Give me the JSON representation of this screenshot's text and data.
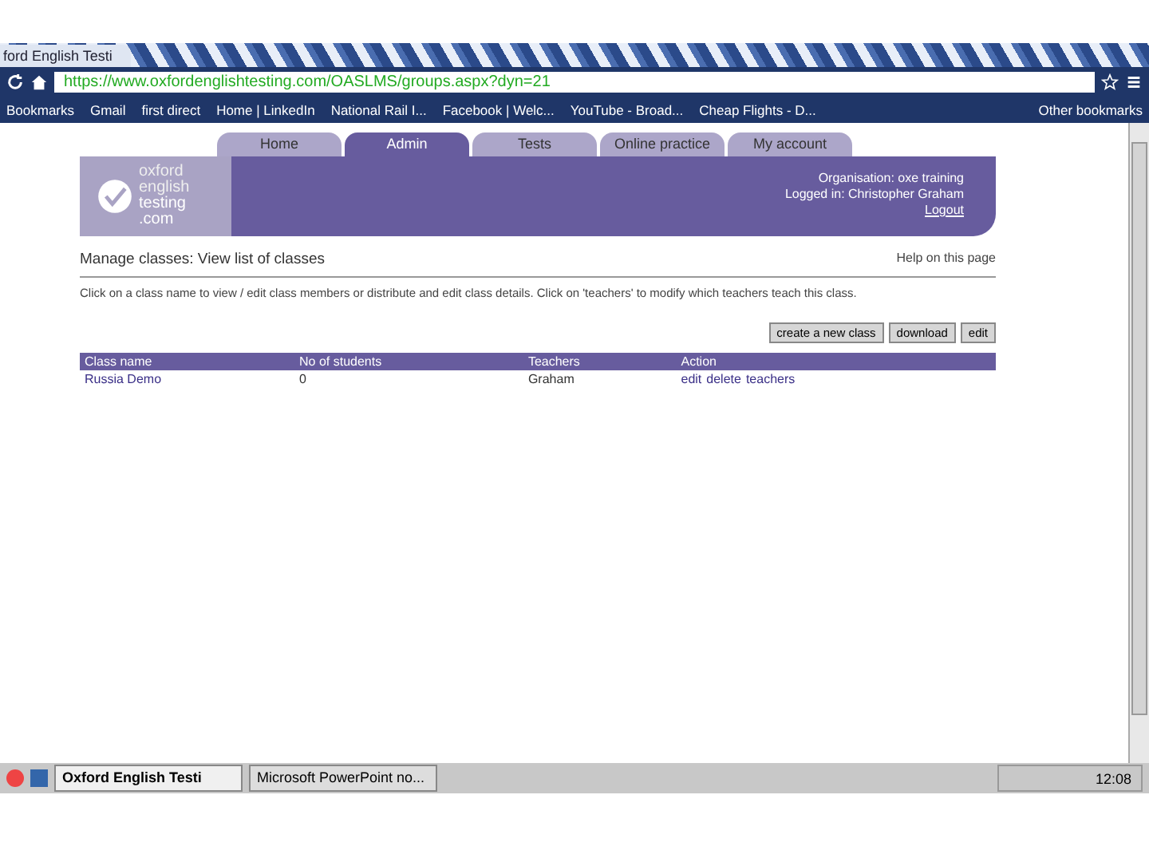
{
  "browser": {
    "tab_title": "ford English Testi",
    "url": "https://www.oxfordenglishtesting.com/OASLMS/groups.aspx?dyn=21",
    "bookmarks": [
      "Bookmarks",
      "Gmail",
      "first direct",
      "Home | LinkedIn",
      "National Rail I...",
      "Facebook | Welc...",
      "YouTube - Broad...",
      "Cheap Flights - D..."
    ],
    "other_bookmarks": "Other bookmarks"
  },
  "nav_tabs": [
    {
      "label": "Home",
      "selected": false
    },
    {
      "label": "Admin",
      "selected": true
    },
    {
      "label": "Tests",
      "selected": false
    },
    {
      "label": "Online practice",
      "selected": false
    },
    {
      "label": "My account",
      "selected": false
    }
  ],
  "logo": [
    "oxford",
    "english",
    "testing",
    ".com"
  ],
  "header": {
    "organisation": "Organisation: oxe training",
    "logged_in": "Logged in: Christopher Graham",
    "logout": "Logout"
  },
  "page_title": "Manage classes: View list of classes",
  "help": "Help on this page",
  "instructions": "Click on a class name to view / edit class members or distribute and edit class details. Click on 'teachers' to modify which teachers teach this class.",
  "buttons": [
    "create a new class",
    "download",
    "edit"
  ],
  "table": {
    "columns": [
      "Class name",
      "No of students",
      "Teachers",
      "Action"
    ],
    "rows": [
      {
        "class_name": "Russia Demo",
        "students": "0",
        "teachers": "Graham",
        "actions": [
          "edit",
          "delete",
          "teachers"
        ]
      }
    ]
  },
  "taskbar": {
    "windows": [
      {
        "label": "Oxford English Testi",
        "selected": true
      },
      {
        "label": "Microsoft PowerPoint no...",
        "selected": false
      }
    ],
    "clock": "12:08"
  }
}
